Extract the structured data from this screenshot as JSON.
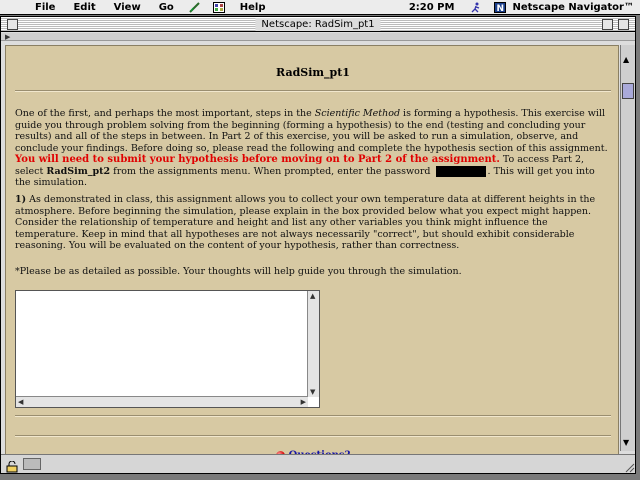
{
  "menubar": {
    "items": [
      "File",
      "Edit",
      "View",
      "Go",
      "Help"
    ],
    "clock": "2:20 PM",
    "app_name": "Netscape Navigator™"
  },
  "window": {
    "title": "Netscape: RadSim_pt1"
  },
  "page": {
    "title": "RadSim_pt1",
    "intro_1": "One of the first, and perhaps the most important, steps in the ",
    "intro_italic": "Scientific Method",
    "intro_2": " is forming a hypothesis. This exercise will guide you through problem solving from the beginning (forming a hypothesis) to the end (testing and concluding your results) and all of the steps in between. In Part 2 of this exercise, you will be asked to run a simulation, observe, and conclude your findings. Before doing so, please read the following and complete the hypothesis section of this assignment. ",
    "intro_red": "You will need to submit your hypothesis before moving on to Part 2 of the assignment.",
    "intro_3": " To access Part 2, select ",
    "intro_bold": "RadSim_pt2",
    "intro_4": " from the assignments menu. When prompted, enter the password ",
    "intro_5": ". This will get you into the simulation.",
    "q1_num": "1)",
    "q1_text": " As demonstrated in class, this assignment allows you to collect your own temperature data at different heights in the atmosphere. Before beginning the simulation, please explain in the box provided below what you expect might happen. Consider the relationship of temperature and height and list any other variables you think might influence the temperature. Keep in mind that all hypotheses are not always necessarily \"correct\", but should exhibit considerable reasoning. You will be evaluated on the content of your hypothesis, rather than correctness.",
    "note": "*Please be as detailed as possible. Your thoughts will help guide you through the simulation.",
    "answer_value": "",
    "questions_link": "Questions?"
  }
}
